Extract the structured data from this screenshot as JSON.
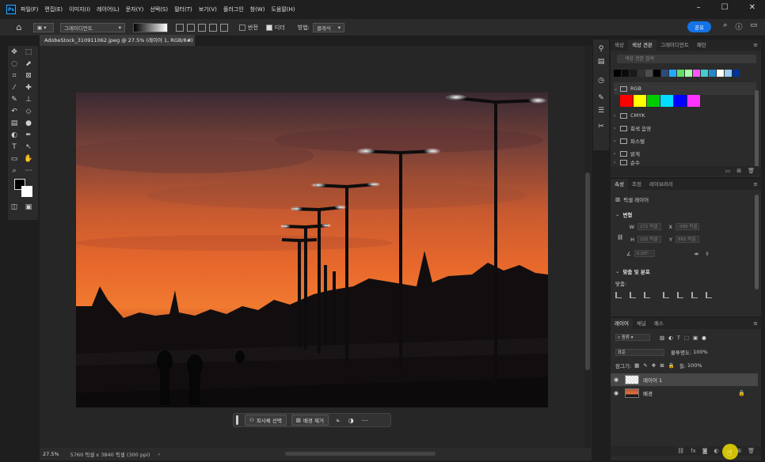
{
  "menu": [
    "파일(F)",
    "편집(E)",
    "이미지(I)",
    "레이어(L)",
    "문자(Y)",
    "선택(S)",
    "필터(T)",
    "보기(V)",
    "플러그인",
    "창(W)",
    "도움말(H)"
  ],
  "options": {
    "gradient_type": "그레이디언트",
    "reverse_label": "반전",
    "dither_label": "디더",
    "method_label": "방법:",
    "method_value": "클래식",
    "share_label": "공유"
  },
  "document": {
    "tab_title": "AdobeStock_310911062.jpeg @ 27.5% (레이어 1, RGB/8#) *"
  },
  "context_bar": {
    "select_subject": "피사체 선택",
    "remove_bg": "배경 제거"
  },
  "status": {
    "zoom": "27.5%",
    "info": "5760 픽셀 x 3840 픽셀 (300 ppi)"
  },
  "swatches_panel": {
    "tabs": [
      "색상",
      "색상 견본",
      "그레이디언트",
      "패턴"
    ],
    "active_tab": 1,
    "search_placeholder": "색상 견본 검색",
    "recent": [
      "#000000",
      "#0b0b0b",
      "#1a1a1a",
      "#333333",
      "#4d4d4d",
      "#000000",
      "#2c4a7a",
      "#22aaff",
      "#66dd66",
      "#aaffaa",
      "#ff55ff",
      "#44cccc",
      "#2288cc",
      "#ffffff",
      "#99ccee",
      "#003399"
    ],
    "folders": [
      "RGB",
      "CMYK",
      "회색 음영",
      "파스텔",
      "밝게",
      "순수"
    ],
    "rgb_colors": [
      "#ff0000",
      "#ffff00",
      "#00cc00",
      "#00ddff",
      "#0000ff",
      "#ff33ff"
    ]
  },
  "properties_panel": {
    "tabs": [
      "속성",
      "조정",
      "라이브러리"
    ],
    "active_tab": 0,
    "layer_type": "픽셀 레이어",
    "transform_title": "변형",
    "w_label": "W",
    "x_label": "X",
    "h_label": "H",
    "y_label": "Y",
    "w_value": "272 픽셀",
    "x_value": "-388 픽셀",
    "h_value": "225 픽셀",
    "y_value": "865 픽셀",
    "angle_value": "0.00°",
    "align_title": "맞춤 및 분포",
    "align_label": "맞춤:"
  },
  "layers_panel": {
    "tabs": [
      "레이어",
      "채널",
      "패스"
    ],
    "active_tab": 0,
    "filter_label": "종류",
    "blend_mode": "표준",
    "opacity_label": "불투명도:",
    "opacity_value": "100%",
    "lock_label": "잠그기:",
    "fill_label": "칠:",
    "fill_value": "100%",
    "layers": [
      {
        "name": "레이어 1",
        "selected": true
      },
      {
        "name": "배경",
        "selected": false,
        "locked": true
      }
    ]
  }
}
